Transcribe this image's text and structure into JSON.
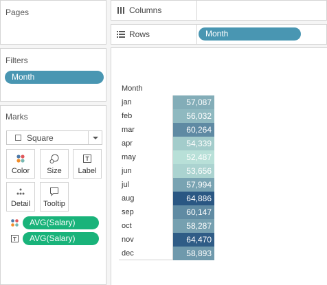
{
  "pages": {
    "title": "Pages"
  },
  "filters": {
    "title": "Filters",
    "pills": [
      "Month"
    ]
  },
  "marks": {
    "title": "Marks",
    "mark_type": "Square",
    "buttons": [
      {
        "label": "Color",
        "icon": "color-icon"
      },
      {
        "label": "Size",
        "icon": "size-icon"
      },
      {
        "label": "Label",
        "icon": "label-icon"
      },
      {
        "label": "Detail",
        "icon": "detail-icon"
      },
      {
        "label": "Tooltip",
        "icon": "tooltip-icon"
      }
    ],
    "fields": [
      {
        "icon": "color-icon",
        "label": "AVG(Salary)"
      },
      {
        "icon": "label-icon",
        "label": "AVG(Salary)"
      }
    ]
  },
  "shelves": {
    "columns": {
      "label": "Columns",
      "icon": "columns-icon"
    },
    "rows": {
      "label": "Rows",
      "icon": "rows-icon",
      "pill": "Month"
    }
  },
  "colors": {
    "pill_blue": "#4996b2",
    "pill_green": "#19b37a"
  },
  "chart_data": {
    "type": "heatmap",
    "row_header": "Month",
    "categories": [
      "jan",
      "feb",
      "mar",
      "apr",
      "may",
      "jun",
      "jul",
      "aug",
      "sep",
      "oct",
      "nov",
      "dec"
    ],
    "labels": [
      "57,087",
      "56,032",
      "60,264",
      "54,339",
      "52,487",
      "53,656",
      "57,994",
      "64,886",
      "60,147",
      "58,287",
      "64,470",
      "58,893"
    ],
    "values": [
      57087,
      56032,
      60264,
      54339,
      52487,
      53656,
      57994,
      64886,
      60147,
      58287,
      64470,
      58893
    ],
    "color_scale": [
      "#b8e0d8",
      "#2a5783"
    ]
  }
}
